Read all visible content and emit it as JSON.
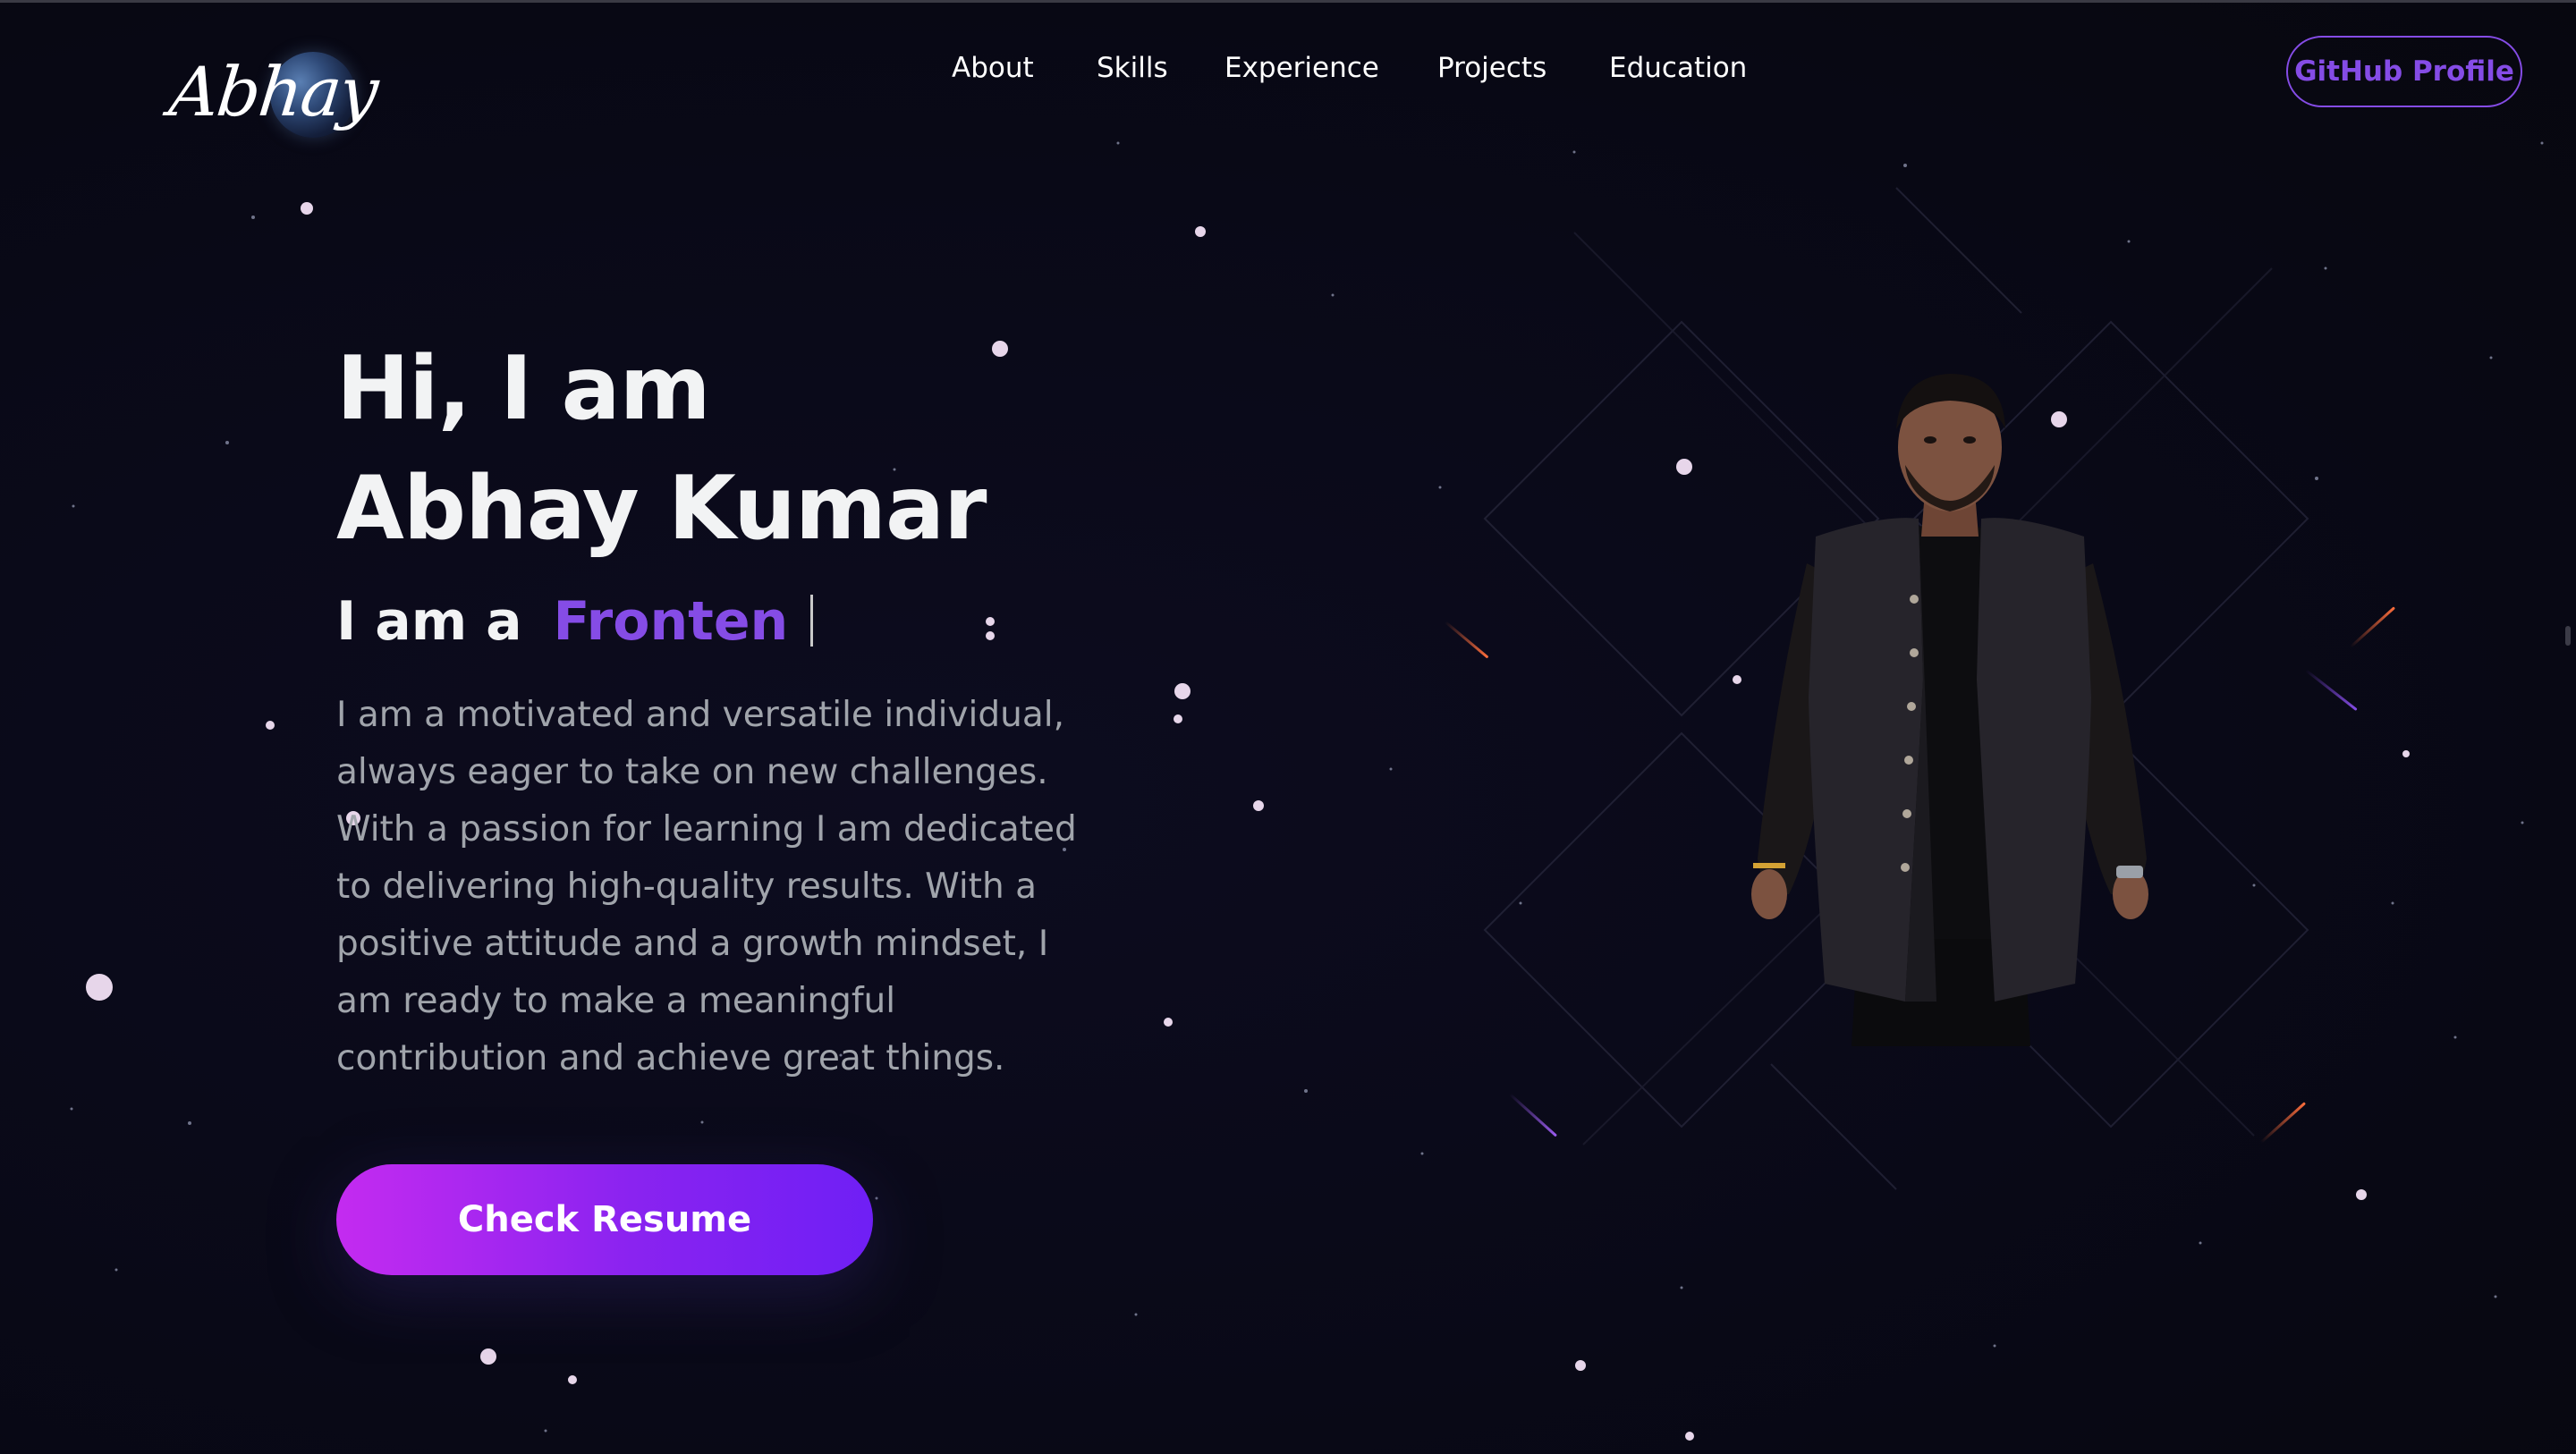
{
  "nav": {
    "logo_text": "Abhay",
    "links": [
      {
        "label": "About"
      },
      {
        "label": "Skills"
      },
      {
        "label": "Experience"
      },
      {
        "label": "Projects"
      },
      {
        "label": "Education"
      }
    ],
    "github_label": "GitHub Profile"
  },
  "hero": {
    "greeting": "Hi, I am",
    "name": "Abhay Kumar",
    "role_prefix": "I am a",
    "role_typed": "Fronten",
    "description": "I am a motivated and versatile individual, always eager to take on new challenges. With a passion for learning I am dedicated to delivering high-quality results. With a positive attitude and a growth mindset, I am ready to make a meaningful contribution and achieve great things.",
    "resume_label": "Check Resume"
  },
  "colors": {
    "accent": "#854CE6",
    "background": "#090917",
    "text_primary": "#F2F3F4",
    "text_secondary": "#A0A4AB",
    "button_gradient_start": "#C42BF0",
    "button_gradient_end": "#6F1FF5"
  },
  "icons": {
    "logo": "moon-icon",
    "portrait": "person-portrait"
  }
}
